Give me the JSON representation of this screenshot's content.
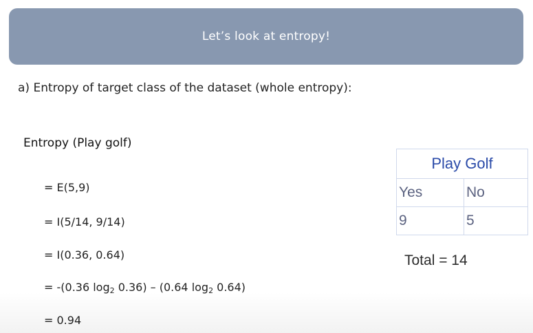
{
  "banner": {
    "title": "Let’s look at entropy!"
  },
  "subtitle": "a) Entropy of target class of the dataset (whole entropy):",
  "entropy": {
    "heading": "Entropy (Play golf)",
    "step1": "= E(5,9)",
    "step2": "= I(5/14, 9/14)",
    "step3": "= I(0.36, 0.64)",
    "step4": {
      "prefix": "= -(0.36 log",
      "sub_a": "2",
      "mid": " 0.36) – (0.64 log",
      "sub_b": "2",
      "suffix": " 0.64)"
    },
    "step5": "= 0.94"
  },
  "table": {
    "header": "Play Golf",
    "col_yes": "Yes",
    "col_no": "No",
    "val_yes": "9",
    "val_no": "5"
  },
  "total": "Total = 14",
  "colors": {
    "banner_bg": "#8898b0",
    "table_header_text": "#2a4aa8",
    "table_cell_text": "#5b6280"
  }
}
